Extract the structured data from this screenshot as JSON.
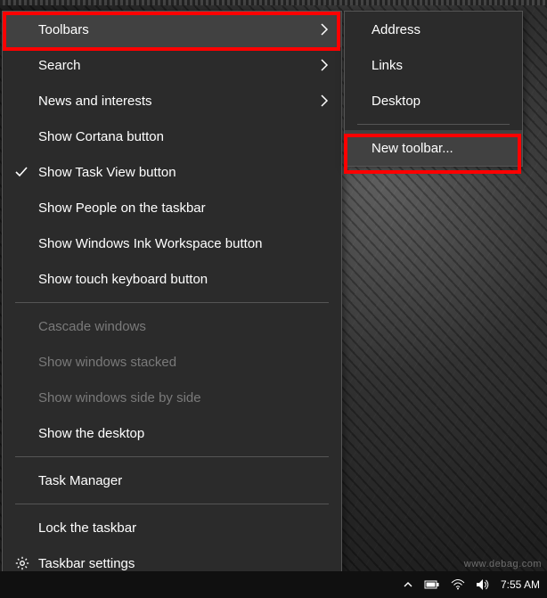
{
  "mainMenu": {
    "items": [
      {
        "label": "Toolbars",
        "submenu": true,
        "hover": true
      },
      {
        "label": "Search",
        "submenu": true
      },
      {
        "label": "News and interests",
        "submenu": true
      },
      {
        "label": "Show Cortana button"
      },
      {
        "label": "Show Task View button",
        "checked": true
      },
      {
        "label": "Show People on the taskbar"
      },
      {
        "label": "Show Windows Ink Workspace button"
      },
      {
        "label": "Show touch keyboard button"
      },
      {
        "sep": true
      },
      {
        "label": "Cascade windows",
        "disabled": true
      },
      {
        "label": "Show windows stacked",
        "disabled": true
      },
      {
        "label": "Show windows side by side",
        "disabled": true
      },
      {
        "label": "Show the desktop"
      },
      {
        "sep": true
      },
      {
        "label": "Task Manager"
      },
      {
        "sep": true
      },
      {
        "label": "Lock the taskbar"
      },
      {
        "label": "Taskbar settings",
        "icon": "gear"
      }
    ]
  },
  "subMenu": {
    "items": [
      {
        "label": "Address"
      },
      {
        "label": "Links"
      },
      {
        "label": "Desktop"
      },
      {
        "sep": true
      },
      {
        "label": "New toolbar...",
        "hover": true
      }
    ]
  },
  "taskbar": {
    "clock": "7:55 AM"
  },
  "watermark": "www.debag.com"
}
